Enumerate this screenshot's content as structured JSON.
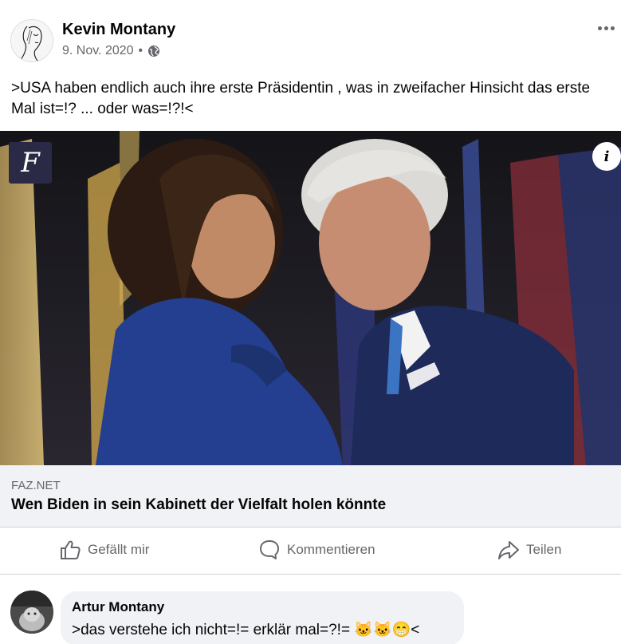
{
  "post": {
    "author": "Kevin Montany",
    "date": "9. Nov. 2020",
    "separator": "•",
    "privacy_icon": "globe-icon",
    "text": ">USA haben endlich auch ihre erste Präsidentin , was in zweifacher Hinsicht das erste Mal ist=!? ... oder was=!?!<"
  },
  "image": {
    "publisher_logo_letter": "F",
    "info_label": "i"
  },
  "link_preview": {
    "domain": "FAZ.NET",
    "title": "Wen Biden in sein Kabinett der Vielfalt holen könnte"
  },
  "actions": {
    "like": "Gefällt mir",
    "comment": "Kommentieren",
    "share": "Teilen"
  },
  "comment": {
    "author": "Artur Montany",
    "text": ">das verstehe ich nicht=!= erklär mal=?!= 🐱🐱😁<"
  },
  "colors": {
    "text_primary": "#050505",
    "text_secondary": "#65676b",
    "preview_bg": "#f0f2f5",
    "divider": "#ced0d4"
  }
}
